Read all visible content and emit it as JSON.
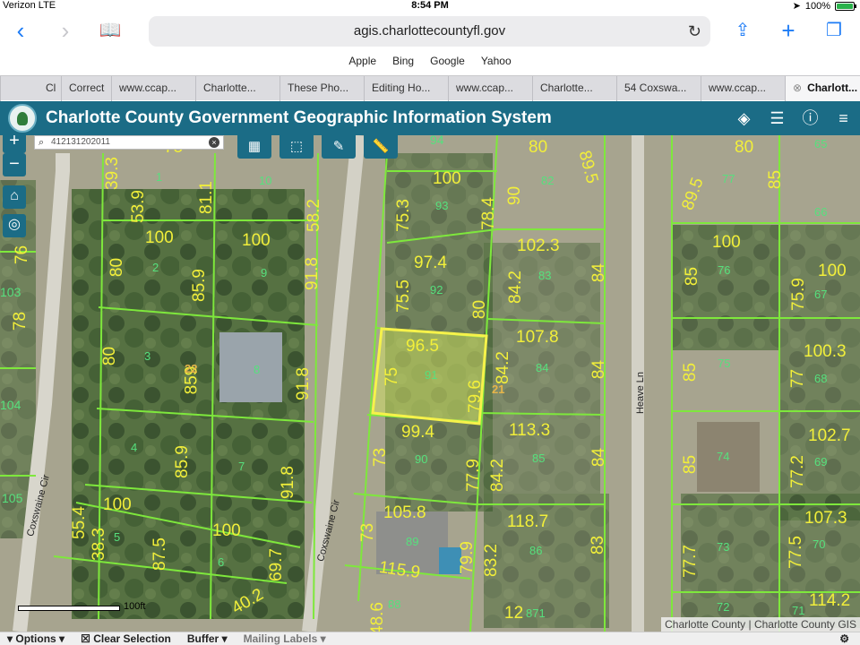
{
  "status": {
    "carrier": "Verizon",
    "network": "LTE",
    "time": "8:54 PM",
    "battery": "100%"
  },
  "browser": {
    "url": "agis.charlottecountyfl.gov",
    "favorites": [
      "Apple",
      "Bing",
      "Google",
      "Yahoo"
    ],
    "tabs": [
      {
        "label": "Cl"
      },
      {
        "label": "Correct"
      },
      {
        "label": "www.ccap..."
      },
      {
        "label": "Charlotte..."
      },
      {
        "label": "These Pho..."
      },
      {
        "label": "Editing Ho..."
      },
      {
        "label": "www.ccap..."
      },
      {
        "label": "Charlotte..."
      },
      {
        "label": "54 Coxswa..."
      },
      {
        "label": "www.ccap..."
      },
      {
        "label": "Charlott...",
        "active": true
      }
    ]
  },
  "app": {
    "title": "Charlotte County Government Geographic Information System"
  },
  "map": {
    "search_value": "412131202011",
    "scale_label": "100ft",
    "attribution": "Charlotte County | Charlotte County GIS",
    "roads": {
      "left": "Coxswaine Cir",
      "center": "Coxswaine Cir",
      "right": "Heave Ln"
    },
    "dimension_labels": [
      "75",
      "39.3",
      "53.9",
      "81.1",
      "100",
      "58.2",
      "100",
      "80",
      "85.9",
      "91.8",
      "80",
      "859",
      "91.8",
      "85.9",
      "91.8",
      "100",
      "55.4",
      "38.3",
      "87.5",
      "100",
      "69.7",
      "40.2",
      "100",
      "75.3",
      "78.4",
      "97.4",
      "75.5",
      "80",
      "96.5",
      "75",
      "79.6",
      "84.2",
      "99.4",
      "73",
      "77.9",
      "84.2",
      "105.8",
      "73",
      "115.9",
      "79.9",
      "83.2",
      "48.6",
      "80",
      "89.5",
      "90",
      "102.3",
      "84",
      "84.2",
      "107.8",
      "84",
      "113.3",
      "84",
      "118.7",
      "83",
      "12",
      "80",
      "89.5",
      "85",
      "100",
      "85",
      "75.9",
      "100",
      "85",
      "77",
      "100.3",
      "85",
      "77.2",
      "102.7",
      "77.7",
      "77.5",
      "107.3",
      "114.2",
      "76",
      "103",
      "78",
      "104",
      "105",
      "94"
    ],
    "parcel_ids": [
      "1",
      "10",
      "2",
      "9",
      "3",
      "8",
      "4",
      "7",
      "5",
      "6",
      "93",
      "92",
      "91",
      "90",
      "89",
      "88",
      "82",
      "83",
      "84",
      "85",
      "86",
      "871",
      "77",
      "76",
      "75",
      "74",
      "73",
      "72",
      "66",
      "67",
      "68",
      "69",
      "70",
      "71",
      "65"
    ],
    "address_labels": [
      "22",
      "21"
    ],
    "selected_parcel": "91"
  },
  "bottom": {
    "options_label": "Options",
    "clear_label": "Clear Selection",
    "buffer_label": "Buffer",
    "mailing_label": "Mailing Labels"
  },
  "colors": {
    "header": "#1b6c86",
    "dimension": "#f2ef3a",
    "parcel_line": "#7ee83c",
    "selected": "#f6f24a"
  }
}
